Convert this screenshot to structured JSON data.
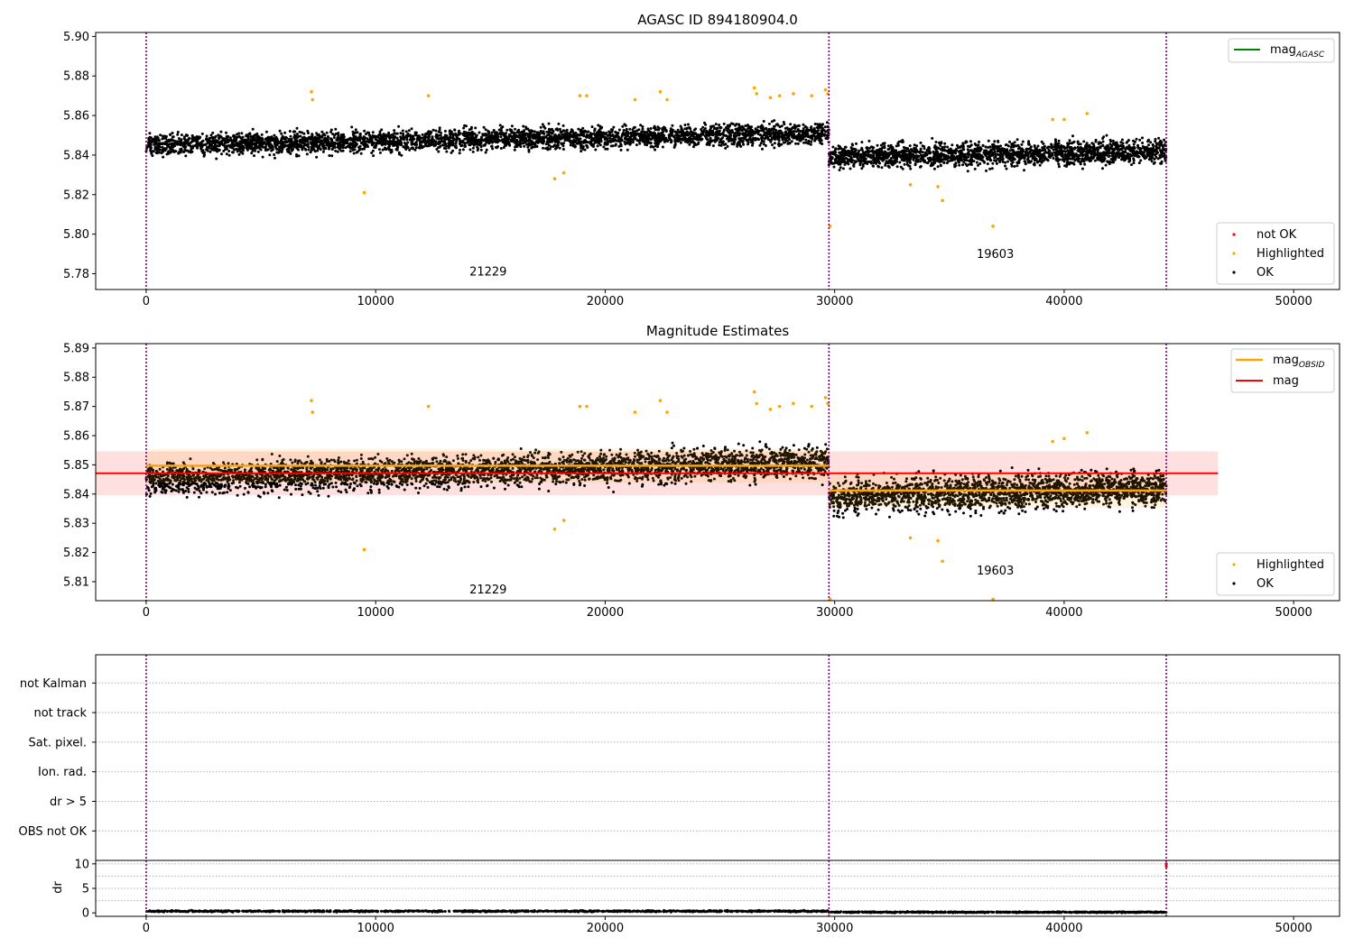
{
  "chart_data": [
    {
      "type": "scatter",
      "title": "AGASC ID 894180904.0",
      "xlim": [
        -2200,
        52000
      ],
      "ylim": [
        5.772,
        5.902
      ],
      "xticks": [
        0,
        10000,
        20000,
        30000,
        40000,
        50000
      ],
      "yticks": [
        5.78,
        5.8,
        5.82,
        5.84,
        5.86,
        5.88,
        5.9
      ],
      "vlines": [
        0,
        29750,
        44450
      ],
      "series": [
        {
          "name": "OK",
          "color": "#000000",
          "segments": [
            {
              "x0": 0,
              "x1": 29750,
              "ystart": 5.845,
              "yend": 5.851,
              "halfwidth": 0.009
            },
            {
              "x0": 29750,
              "x1": 44450,
              "ystart": 5.839,
              "yend": 5.842,
              "halfwidth": 0.01
            }
          ]
        },
        {
          "name": "Highlighted",
          "color": "#ffa500",
          "points": [
            [
              7200,
              5.872
            ],
            [
              7250,
              5.868
            ],
            [
              9500,
              5.821
            ],
            [
              12300,
              5.87
            ],
            [
              17800,
              5.828
            ],
            [
              18200,
              5.831
            ],
            [
              18900,
              5.87
            ],
            [
              19200,
              5.87
            ],
            [
              21300,
              5.868
            ],
            [
              22400,
              5.872
            ],
            [
              22700,
              5.868
            ],
            [
              26500,
              5.874
            ],
            [
              26600,
              5.871
            ],
            [
              27200,
              5.869
            ],
            [
              27600,
              5.87
            ],
            [
              28200,
              5.871
            ],
            [
              29000,
              5.87
            ],
            [
              29600,
              5.873
            ],
            [
              29700,
              5.871
            ],
            [
              29800,
              5.804
            ],
            [
              33300,
              5.825
            ],
            [
              34500,
              5.824
            ],
            [
              34700,
              5.817
            ],
            [
              36900,
              5.804
            ],
            [
              39500,
              5.858
            ],
            [
              40000,
              5.858
            ],
            [
              41000,
              5.861
            ]
          ]
        },
        {
          "name": "not OK",
          "color": "#ff0000",
          "points": []
        }
      ],
      "reference_lines": [
        {
          "name": "mag_AGASC",
          "color": "#008000"
        }
      ],
      "annotations": [
        {
          "text": "21229",
          "x": 14900,
          "y": 5.779
        },
        {
          "text": "19603",
          "x": 37000,
          "y": 5.788
        }
      ],
      "legends": [
        {
          "location": "upper-right",
          "entries": [
            {
              "label": "mag",
              "sub": "AGASC",
              "kind": "line",
              "color": "#008000"
            }
          ]
        },
        {
          "location": "lower-right",
          "entries": [
            {
              "label": "not OK",
              "kind": "dot",
              "color": "#ff0000"
            },
            {
              "label": "Highlighted",
              "kind": "dot",
              "color": "#ffa500"
            },
            {
              "label": "OK",
              "kind": "dot",
              "color": "#000000"
            }
          ]
        }
      ]
    },
    {
      "type": "scatter",
      "title": "Magnitude Estimates",
      "xlim": [
        -2200,
        52000
      ],
      "ylim": [
        5.8035,
        5.8915
      ],
      "xticks": [
        0,
        10000,
        20000,
        30000,
        40000,
        50000
      ],
      "yticks": [
        5.81,
        5.82,
        5.83,
        5.84,
        5.85,
        5.86,
        5.87,
        5.88,
        5.89
      ],
      "vlines": [
        0,
        29750,
        44450
      ],
      "series": [
        {
          "name": "OK",
          "color": "#000000",
          "segments": [
            {
              "x0": 0,
              "x1": 29750,
              "ystart": 5.845,
              "yend": 5.851,
              "halfwidth": 0.009
            },
            {
              "x0": 29750,
              "x1": 44450,
              "ystart": 5.839,
              "yend": 5.842,
              "halfwidth": 0.01
            }
          ]
        },
        {
          "name": "Highlighted",
          "color": "#ffa500",
          "points": [
            [
              7200,
              5.872
            ],
            [
              7250,
              5.868
            ],
            [
              9500,
              5.821
            ],
            [
              12300,
              5.87
            ],
            [
              17800,
              5.828
            ],
            [
              18200,
              5.831
            ],
            [
              18900,
              5.87
            ],
            [
              19200,
              5.87
            ],
            [
              21300,
              5.868
            ],
            [
              22400,
              5.872
            ],
            [
              22700,
              5.868
            ],
            [
              26500,
              5.875
            ],
            [
              26600,
              5.871
            ],
            [
              27200,
              5.869
            ],
            [
              27600,
              5.87
            ],
            [
              28200,
              5.871
            ],
            [
              29000,
              5.87
            ],
            [
              29600,
              5.873
            ],
            [
              29700,
              5.871
            ],
            [
              29800,
              5.804
            ],
            [
              33300,
              5.825
            ],
            [
              34500,
              5.824
            ],
            [
              34700,
              5.817
            ],
            [
              36900,
              5.804
            ],
            [
              39500,
              5.858
            ],
            [
              40000,
              5.859
            ],
            [
              41000,
              5.861
            ]
          ]
        }
      ],
      "mag_obsid": [
        {
          "x0": 0,
          "x1": 29750,
          "y": 5.8497,
          "err": 0.0058
        },
        {
          "x0": 29750,
          "x1": 44450,
          "y": 5.8412,
          "err": 0.0058
        }
      ],
      "mag": {
        "x0": -2200,
        "x1": 46700,
        "y": 5.8471,
        "err": 0.0075
      },
      "annotations": [
        {
          "text": "21229",
          "x": 14900,
          "y": 5.806
        },
        {
          "text": "19603",
          "x": 37000,
          "y": 5.8125
        }
      ],
      "legends": [
        {
          "location": "upper-right",
          "entries": [
            {
              "label": "mag",
              "sub": "OBSID",
              "kind": "line",
              "color": "#ffa500"
            },
            {
              "label": "mag",
              "sub": "",
              "kind": "line",
              "color": "#ff0000"
            }
          ]
        },
        {
          "location": "lower-right",
          "entries": [
            {
              "label": "Highlighted",
              "kind": "dot",
              "color": "#ffa500"
            },
            {
              "label": "OK",
              "kind": "dot",
              "color": "#000000"
            }
          ]
        }
      ]
    },
    {
      "type": "scatter",
      "title": "",
      "xlim": [
        -2200,
        52000
      ],
      "categories": [
        "OBS not OK",
        "dr > 5",
        "Ion. rad.",
        "Sat. pixel.",
        "not track",
        "not Kalman"
      ],
      "vlines": [
        0,
        29750,
        44450
      ],
      "grid": true
    },
    {
      "type": "scatter",
      "title": "",
      "ylabel": "dr",
      "xlim": [
        -2200,
        52000
      ],
      "ylim": [
        -0.7,
        10.7
      ],
      "xticks": [
        0,
        10000,
        20000,
        30000,
        40000,
        50000
      ],
      "yticks": [
        0,
        5,
        10
      ],
      "vlines": [
        0,
        29750,
        44450
      ],
      "grid": true,
      "series": [
        {
          "name": "dr",
          "color": "#000000",
          "segments": [
            {
              "x0": 0,
              "x1": 29750,
              "y": 0.35,
              "halfwidth": 0.25
            },
            {
              "x0": 29750,
              "x1": 44450,
              "y": 0.15,
              "halfwidth": 0.2
            }
          ]
        },
        {
          "name": "dr outlier",
          "color": "#ff0000",
          "points": [
            [
              44450,
              9.5
            ],
            [
              44450,
              10
            ]
          ]
        }
      ]
    }
  ]
}
